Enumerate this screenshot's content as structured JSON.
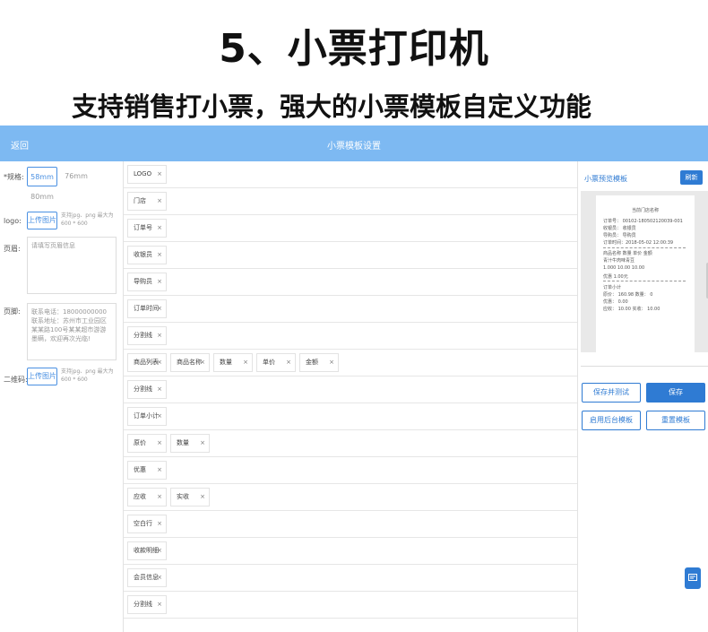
{
  "headline": "5、小票打印机",
  "subheadline": "支持销售打小票，强大的小票模板自定义功能",
  "topbar": {
    "back": "返回",
    "title": "小票模板设置"
  },
  "form": {
    "size_label": "*规格:",
    "sizes": [
      "58mm",
      "76mm",
      "80mm"
    ],
    "logo_label": "logo:",
    "upload_label": "上传图片",
    "upload_hint": "支持jpg、png 最大为600 * 600",
    "header_label": "页眉:",
    "header_placeholder": "请填写页眉信息",
    "footer_label": "页脚:",
    "footer_value": "联系电话：18000000000联系地址：苏州市工业园区某某路100号某某超市游游墨瞒，欢迎再次光临!",
    "qrcode_label": "二维码:",
    "qrcode_upload": "上传图片",
    "qrcode_hint": "支持jpg、png 最大为600 * 600"
  },
  "fields": {
    "remove_mark": "×",
    "rows": [
      [
        "LOGO"
      ],
      [
        "门店"
      ],
      [
        "订单号"
      ],
      [
        "收银员"
      ],
      [
        "导购员"
      ],
      [
        "订单时间"
      ],
      [
        "分割线"
      ],
      [
        "商品列表",
        "商品名称",
        "数量",
        "单价",
        "金额"
      ],
      [
        "分割线"
      ],
      [
        "订单小计"
      ],
      [
        "原价",
        "数量"
      ],
      [
        "优惠"
      ],
      [
        "应收",
        "实收"
      ],
      [
        "空白行"
      ],
      [
        "收款明细"
      ],
      [
        "会员信息"
      ],
      [
        "分割线"
      ]
    ]
  },
  "preview": {
    "title": "小票预览模板",
    "refresh": "刷新",
    "lines": [
      "当前门店名称",
      "订单号：  00102-180502120039-001",
      "收银员：  收银员",
      "导购员：  导购员",
      "订单时间：2018-05-02 12:00:39",
      "商品名称  数量    单价    金额",
      "青汁牛肉味青豆",
      "        1.000   10.00   10.00",
      "优惠 1.00元",
      "订单小计",
      "原价：  160.98   数量：  0",
      "优惠：  0.00",
      "应收：  10.00    实收：  10.00"
    ]
  },
  "actions": {
    "save_test": "保存并测试",
    "save": "保存",
    "enable_backend": "启用后台模板",
    "reset": "重置模板"
  },
  "colors": {
    "accent": "#2f7bd3",
    "topbar": "#7db9f2"
  }
}
